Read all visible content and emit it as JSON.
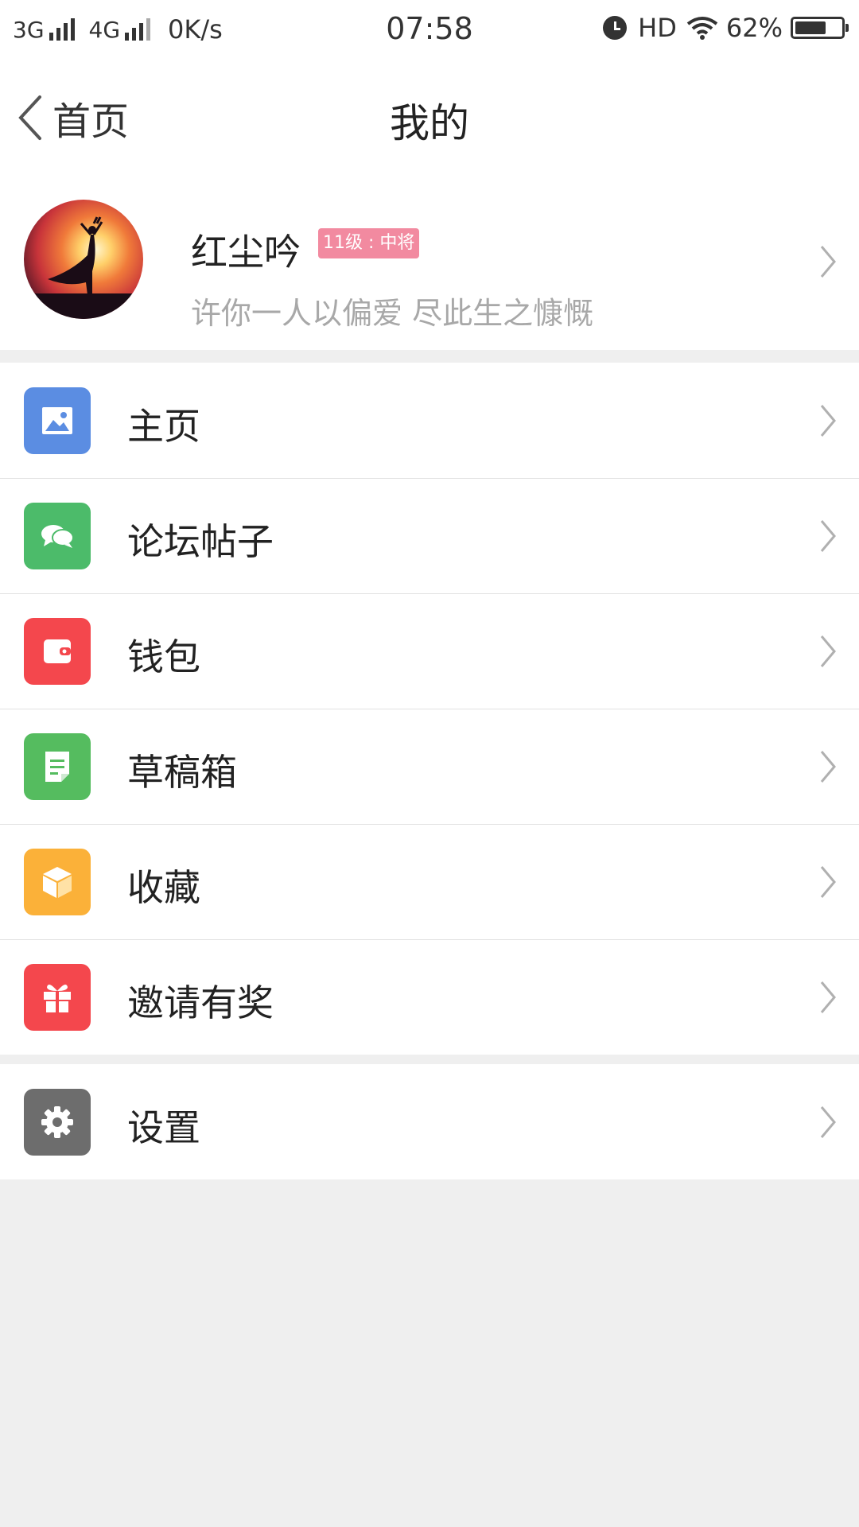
{
  "status_bar": {
    "network1": "3G",
    "network2": "4G",
    "speed": "0K/s",
    "time": "07:58",
    "hd": "HD",
    "battery": "62%"
  },
  "nav": {
    "back_label": "首页",
    "title": "我的"
  },
  "profile": {
    "username": "红尘吟",
    "level": "11级 : 中将",
    "signature": "许你一人以偏爱 尽此生之慷慨"
  },
  "menu": [
    {
      "label": "主页",
      "icon": "image-icon",
      "color": "#5b8de2"
    },
    {
      "label": "论坛帖子",
      "icon": "chat-bubbles-icon",
      "color": "#4cbb6a"
    },
    {
      "label": "钱包",
      "icon": "wallet-icon",
      "color": "#f4474d"
    },
    {
      "label": "草稿箱",
      "icon": "draft-note-icon",
      "color": "#55bc5f"
    },
    {
      "label": "收藏",
      "icon": "box-icon",
      "color": "#fbb139"
    },
    {
      "label": "邀请有奖",
      "icon": "gift-icon",
      "color": "#f4474d"
    }
  ],
  "settings": {
    "label": "设置",
    "icon": "gear-icon",
    "color": "#6d6d6d"
  }
}
